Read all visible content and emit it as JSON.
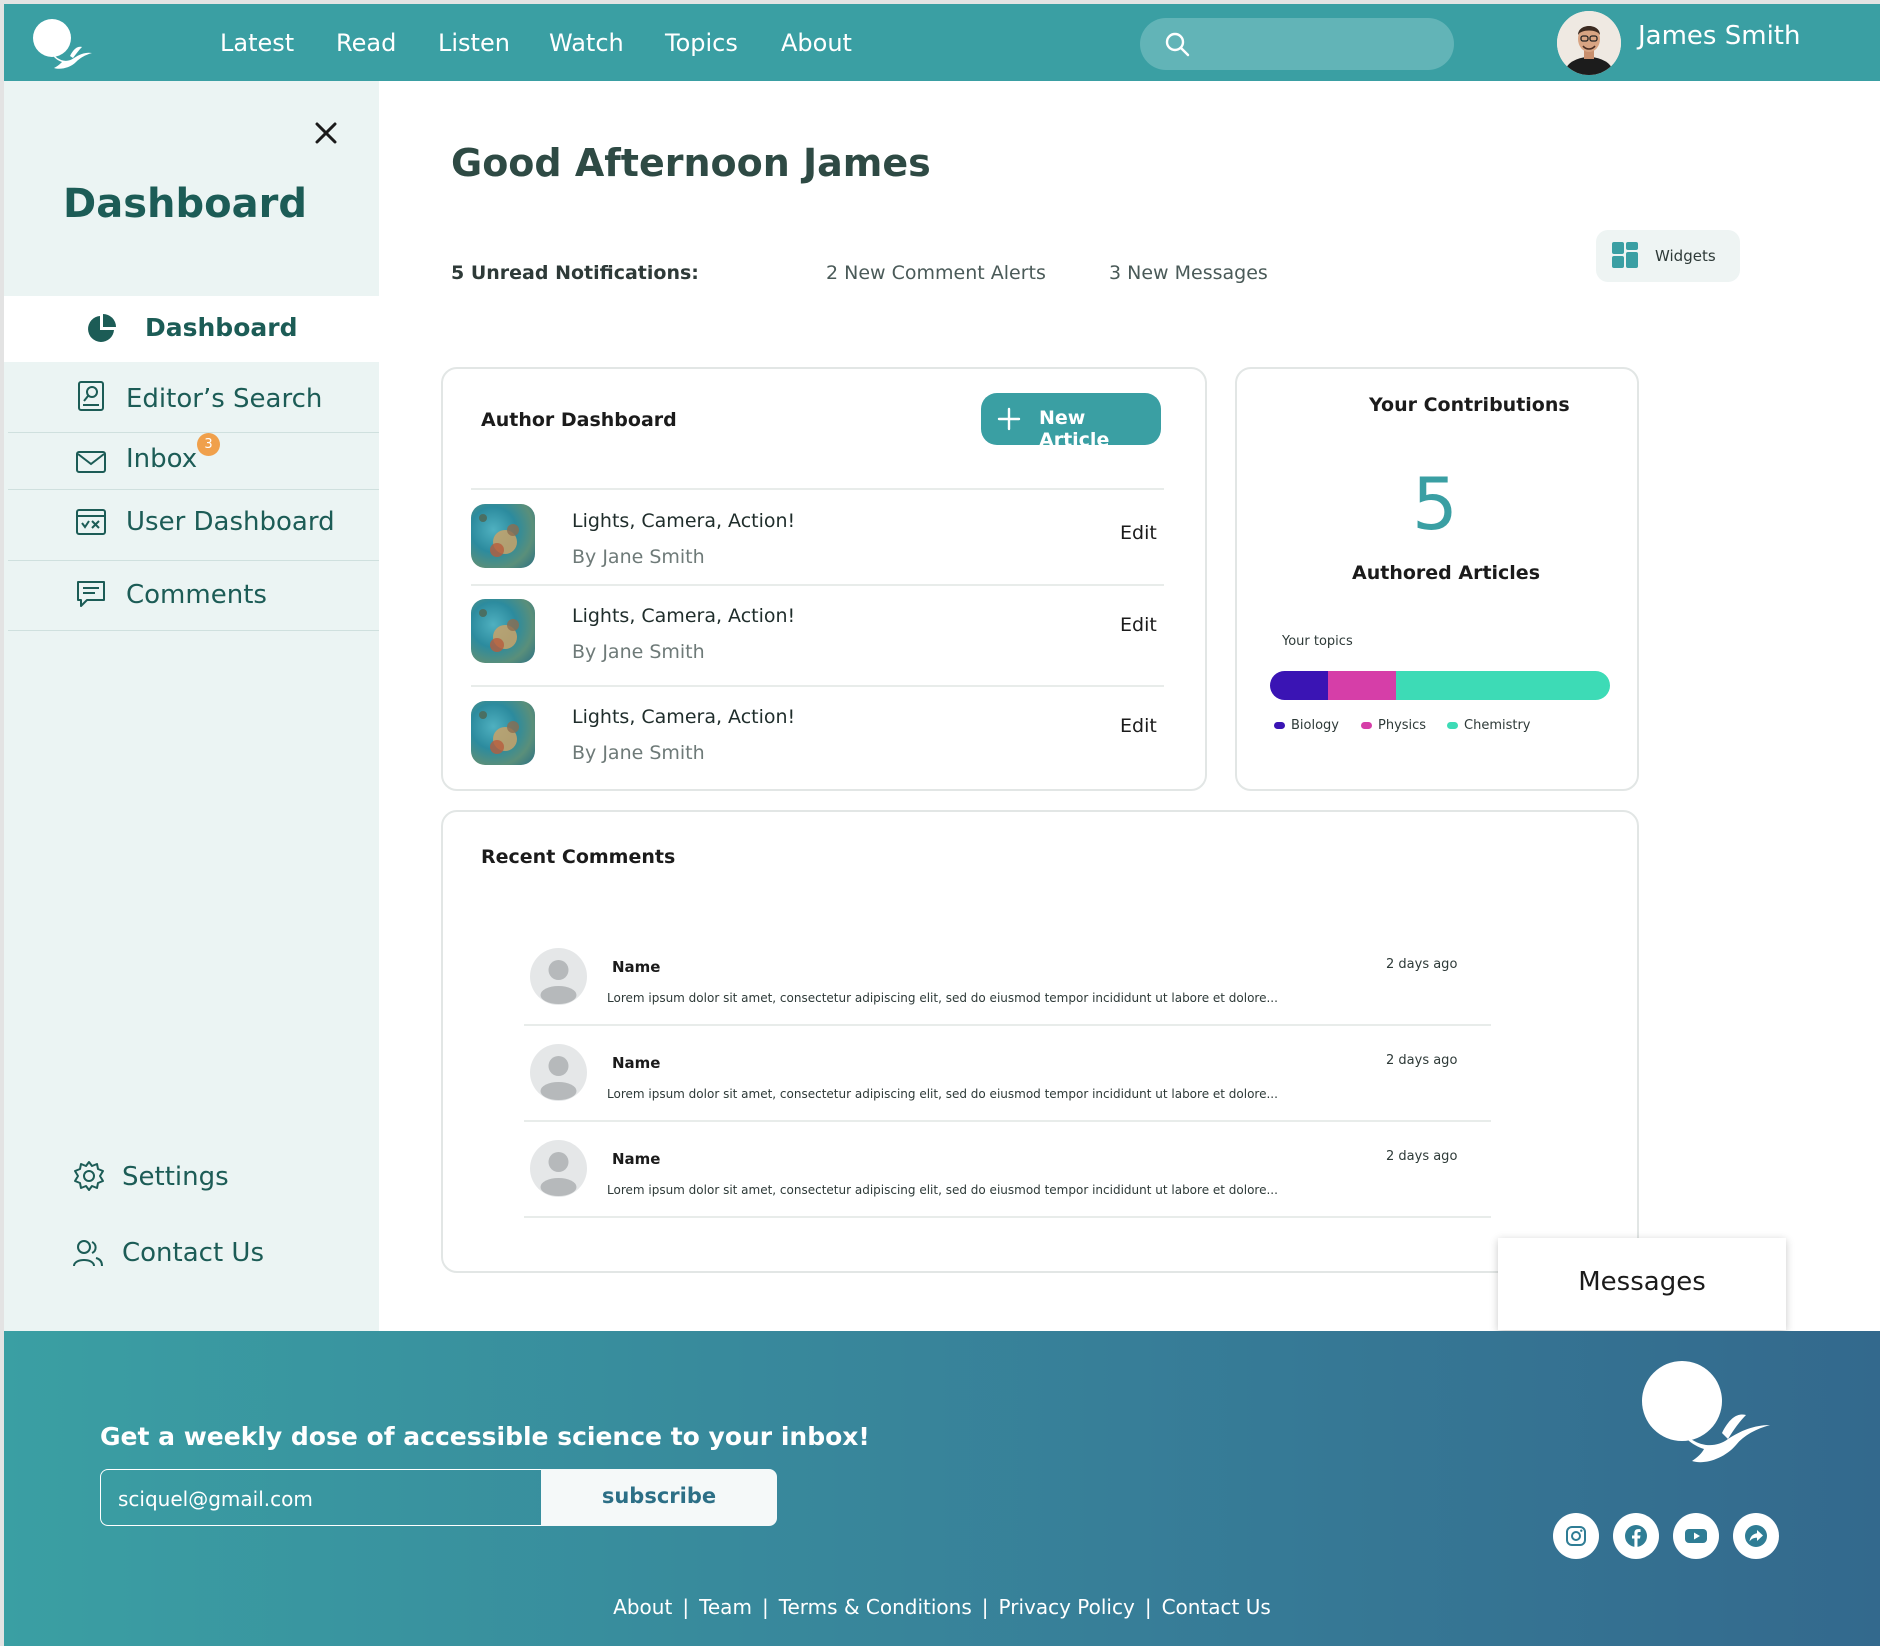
{
  "nav": {
    "links": [
      "Latest",
      "Read",
      "Listen",
      "Watch",
      "Topics",
      "About"
    ],
    "search_placeholder": "",
    "user_name": "James Smith"
  },
  "sidebar": {
    "title": "Dashboard",
    "active_item": "Dashboard",
    "items": [
      {
        "label": "Editor’s Search",
        "icon": "document-search-icon"
      },
      {
        "label": "Inbox",
        "icon": "mail-icon",
        "badge": "3"
      },
      {
        "label": "User Dashboard",
        "icon": "user-dashboard-icon"
      },
      {
        "label": "Comments",
        "icon": "comment-icon"
      }
    ],
    "bottom_items": [
      {
        "label": "Settings",
        "icon": "gear-icon"
      },
      {
        "label": "Contact Us",
        "icon": "users-icon"
      }
    ]
  },
  "main": {
    "greeting": "Good Afternoon James",
    "notifications_label": "5 Unread Notifications:",
    "comment_alerts": "2 New Comment Alerts",
    "new_messages": "3 New Messages",
    "widgets_label": "Widgets"
  },
  "author_dashboard": {
    "title": "Author Dashboard",
    "new_article_label": "New Article",
    "articles": [
      {
        "title": "Lights, Camera, Action!",
        "author": "By Jane Smith",
        "action": "Edit"
      },
      {
        "title": "Lights, Camera, Action!",
        "author": "By Jane Smith",
        "action": "Edit"
      },
      {
        "title": "Lights, Camera, Action!",
        "author": "By Jane Smith",
        "action": "Edit"
      }
    ]
  },
  "contributions": {
    "title": "Your Contributions",
    "count": "5",
    "count_label": "Authored Articles",
    "topics_label": "Your topics",
    "topics": [
      {
        "name": "Biology",
        "share": 0.17,
        "color": "#3a14b4"
      },
      {
        "name": "Physics",
        "share": 0.2,
        "color": "#d63ea8"
      },
      {
        "name": "Chemistry",
        "share": 0.63,
        "color": "#3ddbb6"
      }
    ]
  },
  "recent_comments": {
    "title": "Recent Comments",
    "items": [
      {
        "name": "Name",
        "time": "2 days ago",
        "text": "Lorem ipsum dolor sit amet, consectetur adipiscing elit, sed do eiusmod tempor incididunt ut labore et dolore..."
      },
      {
        "name": "Name",
        "time": "2 days ago",
        "text": "Lorem ipsum dolor sit amet, consectetur adipiscing elit, sed do eiusmod tempor incididunt ut labore et dolore..."
      },
      {
        "name": "Name",
        "time": "2 days ago",
        "text": "Lorem ipsum dolor sit amet, consectetur adipiscing elit, sed do eiusmod tempor incididunt ut labore et dolore..."
      }
    ]
  },
  "messages_popup": {
    "label": "Messages"
  },
  "footer": {
    "heading": "Get a weekly dose of accessible science to your inbox!",
    "email_value": "sciquel@gmail.com",
    "subscribe_label": "subscribe",
    "social": [
      "instagram-icon",
      "facebook-icon",
      "youtube-icon",
      "share-icon"
    ],
    "links": [
      "About",
      "Team",
      "Terms & Conditions",
      "Privacy Policy",
      "Contact Us"
    ],
    "separator": "|"
  },
  "colors": {
    "brand": "#3a9fa3",
    "sidebar_bg": "#ebf4f3",
    "sidebar_text": "#1c5c56",
    "badge": "#f0a04b"
  }
}
